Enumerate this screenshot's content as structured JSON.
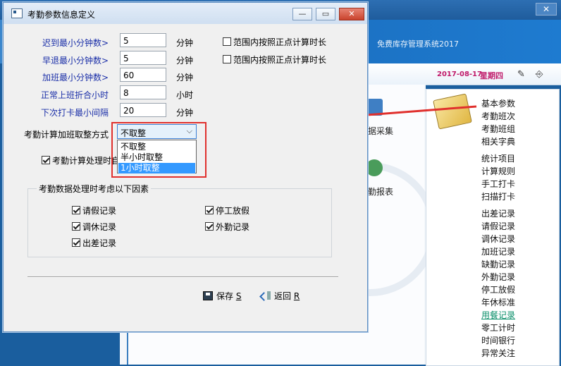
{
  "background": {
    "system_title": "免费库存管理系统2017",
    "close_glyph": "✕",
    "date": "2017-08-17",
    "weekday": "星期四",
    "functions": [
      "据采集",
      "勤报表"
    ],
    "right_menu": [
      "基本参数",
      "考勤班次",
      "考勤班组",
      "相关字典",
      "统计项目",
      "计算规则",
      "手工打卡",
      "扫描打卡",
      "出差记录",
      "请假记录",
      "调休记录",
      "加班记录",
      "缺勤记录",
      "外勤记录",
      "停工放假",
      "年休标准",
      "用餐记录",
      "零工计时",
      "时间银行",
      "异常关注"
    ]
  },
  "dialog": {
    "title": "考勤参数信息定义",
    "buttons": {
      "minimize": "—",
      "maximize": "▭",
      "close": "✕"
    },
    "fields": [
      {
        "label": "迟到最小分钟数>",
        "value": "5",
        "unit": "分钟"
      },
      {
        "label": "早退最小分钟数>",
        "value": "5",
        "unit": "分钟"
      },
      {
        "label": "加班最小分钟数>",
        "value": "60",
        "unit": "分钟"
      },
      {
        "label": "正常上班折合小时",
        "value": "8",
        "unit": "小时"
      },
      {
        "label": "下次打卡最小间隔",
        "value": "20",
        "unit": "分钟"
      }
    ],
    "range_checks": [
      {
        "label": "范围内按照正点计算时长",
        "checked": false
      },
      {
        "label": "范围内按照正点计算时长",
        "checked": false
      }
    ],
    "rounding": {
      "label": "考勤计算加班取整方式",
      "selected": "不取整",
      "options": [
        "不取整",
        "半小时取整",
        "1小时取整"
      ],
      "highlighted": "1小时取整"
    },
    "auto_calc": {
      "label": "考勤计算处理时自",
      "checked": true
    },
    "factors": {
      "title": "考勤数据处理时考虑以下因素",
      "items": [
        {
          "label": "请假记录",
          "checked": true
        },
        {
          "label": "停工放假",
          "checked": true
        },
        {
          "label": "调休记录",
          "checked": true
        },
        {
          "label": "外勤记录",
          "checked": true
        },
        {
          "label": "出差记录",
          "checked": true
        }
      ]
    },
    "actions": {
      "save": "保存",
      "save_key": "S",
      "back": "返回",
      "back_key": "R"
    }
  },
  "colors": {
    "annotation": "#e0302d",
    "label_blue": "#1b2fa8",
    "date_magenta": "#c01a6a"
  }
}
